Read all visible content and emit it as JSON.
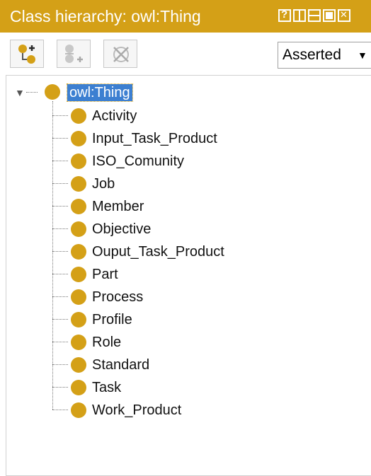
{
  "window": {
    "title": "Class hierarchy: owl:Thing"
  },
  "toolbar": {
    "buttons": [
      {
        "icon": "add-subclass-icon"
      },
      {
        "icon": "add-sibling-icon"
      },
      {
        "icon": "delete-class-icon"
      }
    ],
    "view_select": "Asserted"
  },
  "tree": {
    "root": "owl:Thing",
    "children": [
      "Activity",
      "Input_Task_Product",
      "ISO_Comunity",
      "Job",
      "Member",
      "Objective",
      "Ouput_Task_Product",
      "Part",
      "Process",
      "Profile",
      "Role",
      "Standard",
      "Task",
      "Work_Product"
    ]
  },
  "colors": {
    "accent": "#d4a017",
    "selection": "#3c7fd1"
  }
}
